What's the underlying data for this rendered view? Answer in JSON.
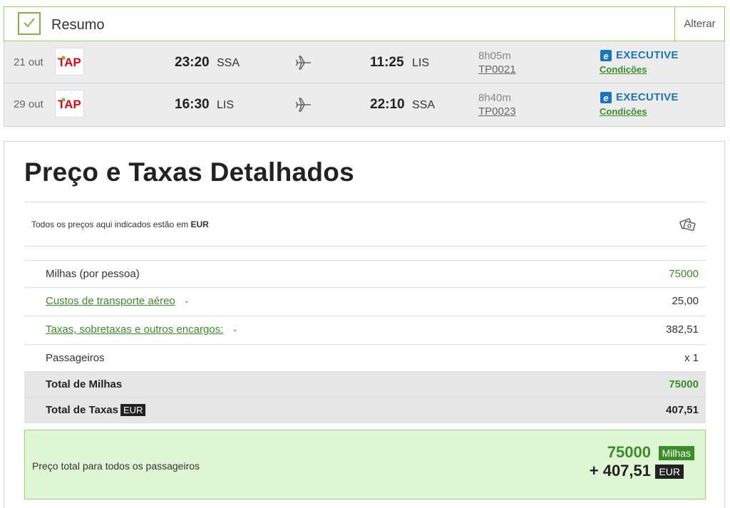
{
  "summary": {
    "title": "Resumo",
    "change_label": "Alterar"
  },
  "flights": [
    {
      "date": "21 out",
      "airline_logo": "TAP",
      "depart_time": "23:20",
      "depart_code": "SSA",
      "arrive_time": "11:25",
      "arrive_code": "LIS",
      "duration": "8h05m",
      "flight_number": "TP0021",
      "cabin_icon": "e",
      "cabin": "EXECUTIVE",
      "conditions": "Condições"
    },
    {
      "date": "29 out",
      "airline_logo": "TAP",
      "depart_time": "16:30",
      "depart_code": "LIS",
      "arrive_time": "22:10",
      "arrive_code": "SSA",
      "duration": "8h40m",
      "flight_number": "TP0023",
      "cabin_icon": "e",
      "cabin": "EXECUTIVE",
      "conditions": "Condições"
    }
  ],
  "price": {
    "title": "Preço e Taxas Detalhados",
    "currency_note_prefix": "Todos os preços aqui indicados estão em",
    "currency_note_currency": "EUR",
    "rows": [
      {
        "label": "Milhas (por pessoa)",
        "value": "75000"
      },
      {
        "label": "Custos de transporte aéreo",
        "value": "25,00",
        "chevron": "⌄"
      },
      {
        "label": "Taxas, sobretaxas e outros encargos:",
        "value": "382,51",
        "chevron": "⌄"
      },
      {
        "label": "Passageiros",
        "value": "x 1"
      }
    ],
    "total_miles_label": "Total de Milhas",
    "total_miles_value": "75000",
    "total_taxes_label": "Total de Taxas",
    "total_taxes_currency": "EUR",
    "total_taxes_value": "407,51",
    "grand_total_label": "Preço total para todos os passageiros",
    "grand_total_miles": "75000",
    "grand_total_miles_unit": "Milhas",
    "grand_total_eur": "+ 407,51",
    "grand_total_eur_unit": "EUR"
  },
  "colors": {
    "accent_green": "#3d8c2a",
    "border_green": "#9fd06f",
    "cabin_blue": "#1e73be",
    "total_bg": "#def6d4"
  }
}
